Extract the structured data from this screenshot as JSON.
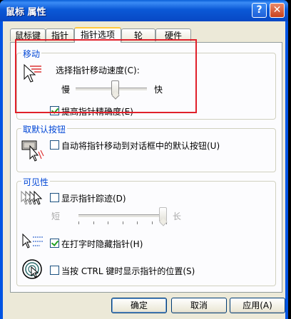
{
  "window": {
    "title": "鼠标 属性",
    "help_glyph": "?",
    "close_glyph": "✕"
  },
  "tabs": [
    "鼠标键",
    "指针",
    "指针选项",
    "轮",
    "硬件"
  ],
  "active_tab": "指针选项",
  "motion": {
    "group_label": "移动",
    "speed_label": "选择指针移动速度(C):",
    "slow_label": "慢",
    "fast_label": "快",
    "speed_level": 0.55,
    "enhance_label": "提高指针精确度(E)",
    "enhance_checked": true
  },
  "snap_to": {
    "group_label": "取默认按钮",
    "label": "自动将指针移动到对话框中的默认按钮(U)",
    "checked": false
  },
  "visibility": {
    "group_label": "可见性",
    "trails_label": "显示指针踪迹(D)",
    "trails_checked": false,
    "short_label": "短",
    "long_label": "长",
    "trails_level": 0.95,
    "hide_label": "在打字时隐藏指针(H)",
    "hide_checked": true,
    "ctrl_label": "当按 CTRL 键时显示指针的位置(S)",
    "ctrl_checked": false
  },
  "buttons": {
    "ok": "确定",
    "cancel": "取消",
    "apply": "应用(A)"
  },
  "colors": {
    "titlebar": "#0a58d6",
    "group_label": "#0046d5",
    "highlight": "#e0202a"
  }
}
